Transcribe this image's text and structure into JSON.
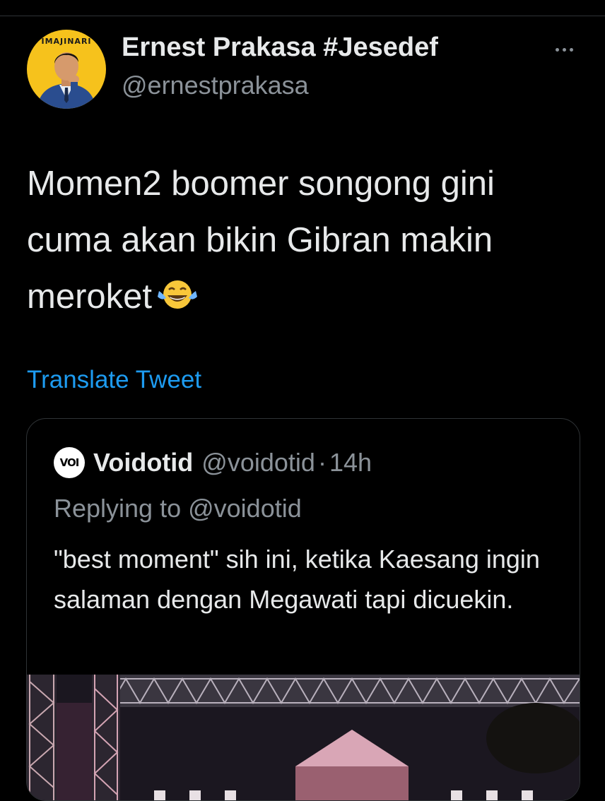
{
  "author": {
    "display_name": "Ernest Prakasa #Jesedef",
    "handle": "@ernestprakasa",
    "avatar_logo_text": "IMAJINARI"
  },
  "tweet": {
    "text": "Momen2 boomer songong gini cuma akan bikin Gibran makin meroket",
    "emoji": "face-with-tears-of-joy",
    "translate_label": "Translate Tweet"
  },
  "quoted_tweet": {
    "avatar_text": "VOI",
    "name": "Voidotid",
    "handle": "@voidotid",
    "separator": "·",
    "time": "14h",
    "replying_to": "Replying to @voidotid",
    "text": "\"best moment\" sih ini, ketika Kaesang ingin salaman dengan Megawati tapi dicuekin."
  },
  "colors": {
    "background": "#000000",
    "text_primary": "#e7e9ea",
    "text_secondary": "#8b9299",
    "link": "#1d9bf0",
    "border": "#2f3336",
    "avatar_bg": "#f6c21c"
  }
}
